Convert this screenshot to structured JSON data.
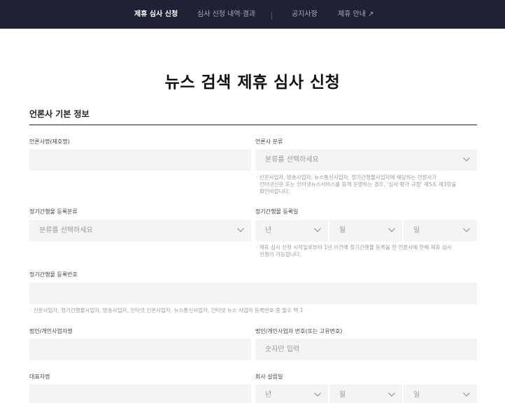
{
  "nav": {
    "items": [
      {
        "label": "제휴 심사 신청",
        "active": true
      },
      {
        "label": "심사 신청 내역·결과",
        "active": false
      },
      {
        "label": "공지사항",
        "active": false
      },
      {
        "label": "제휴 안내",
        "active": false
      }
    ],
    "external_icon": "↗"
  },
  "page": {
    "title": "뉴스 검색 제휴 심사 신청"
  },
  "section": {
    "title": "언론사 기본 정보"
  },
  "form": {
    "press_name": {
      "label": "언론사명(제호명)",
      "value": ""
    },
    "press_category": {
      "label": "언론사 분류",
      "placeholder": "분류를 선택하세요",
      "help_lines": [
        "· 신문사업자, 방송사업자, 뉴스통신사업자, 정기간행물사업자에 해당하는 언론사가",
        "인터넷신문 또는 인터넷뉴스서비스를 함께 운영하는 경우, '심사·평가 규정' 제5조 제3항을",
        "확인바랍니다."
      ]
    },
    "periodical_category": {
      "label": "정기간행물 등록분류",
      "placeholder": "분류를 선택하세요"
    },
    "periodical_date": {
      "label": "정기간행물 등록일",
      "year_placeholder": "년",
      "month_placeholder": "월",
      "day_placeholder": "일",
      "help_lines": [
        "· 제휴 심사 신청 시작일로부터 1년 이전에 정기간행물 등록을 한 언론사에 한해 제휴 심사",
        "신청이 가능합니다."
      ]
    },
    "periodical_number": {
      "label": "정기간행물 등록번호",
      "value": "",
      "help": "· 신문사업자, 정기간행물사업자, 방송사업자, 인터넷 신문사업자, 뉴스통신사업자, 인터넷 뉴스 사업자 등록번호 중 필수 택 1"
    },
    "business_name": {
      "label": "법인/개인사업자명",
      "value": ""
    },
    "business_number": {
      "label": "법인/개인사업자 번호(또는 고유번호)",
      "placeholder": "숫자만 입력"
    },
    "ceo_name": {
      "label": "대표자명",
      "value": ""
    },
    "founding_date": {
      "label": "회사 설립일",
      "year_placeholder": "년",
      "month_placeholder": "월",
      "day_placeholder": "일"
    }
  },
  "colors": {
    "nav_bg": "#1e2234",
    "nav_active": "#ffffff",
    "nav_inactive": "#a9adba",
    "field_bg": "#f4f4f4",
    "help_text": "#9b9b9b"
  }
}
